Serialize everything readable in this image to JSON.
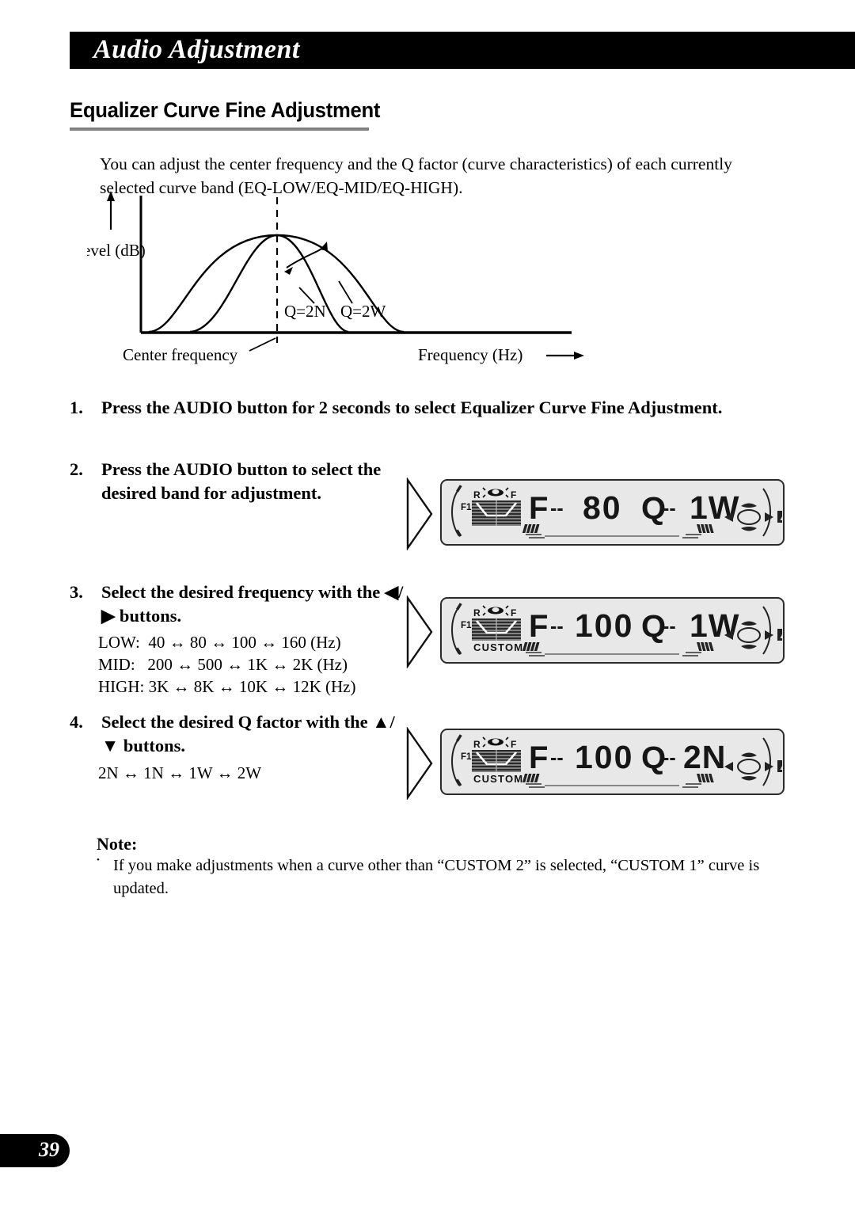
{
  "header": {
    "title": "Audio Adjustment"
  },
  "section": {
    "heading": "Equalizer Curve Fine Adjustment",
    "intro": "You can adjust the center frequency and the Q factor (curve characteristics) of each currently selected curve band (EQ-LOW/EQ-MID/EQ-HIGH)."
  },
  "diagram": {
    "y_axis_label": "Level (dB)",
    "x_axis_label": "Frequency (Hz)",
    "center_label": "Center frequency",
    "curve_narrow_label": "Q=2N",
    "curve_wide_label": "Q=2W"
  },
  "steps": [
    {
      "number": "1.",
      "text": "Press the AUDIO button for 2 seconds to select Equalizer Curve Fine Adjustment."
    },
    {
      "number": "2.",
      "text": "Press the AUDIO button to select the desired band for adjustment."
    },
    {
      "number": "3.",
      "text": "Select the desired frequency with the ◀/▶ buttons.",
      "list": "LOW:  40 ↔ 80 ↔ 100 ↔ 160 (Hz)\nMID:   200 ↔ 500 ↔ 1K ↔ 2K (Hz)\nHIGH: 3K ↔ 8K ↔ 10K ↔ 12K (Hz)"
    },
    {
      "number": "4.",
      "text": "Select the desired Q factor with the ▲/▼ buttons.",
      "list": "2N ↔ 1N ↔ 1W ↔ 2W"
    }
  ],
  "displays": [
    {
      "f_prefix": "F",
      "f_dashes": "--",
      "f_value": "80",
      "q_prefix": "Q",
      "q_dashes": "--",
      "q_value": "1W",
      "source_left": "F1",
      "fader_rear": "R",
      "fader_front": "F",
      "custom_label": ""
    },
    {
      "f_prefix": "F",
      "f_dashes": "--",
      "f_value": "100",
      "q_prefix": "Q",
      "q_dashes": "--",
      "q_value": "1W",
      "source_left": "F1",
      "fader_rear": "R",
      "fader_front": "F",
      "custom_label": "CUSTOM"
    },
    {
      "f_prefix": "F",
      "f_dashes": "--",
      "f_value": "100",
      "q_prefix": "Q",
      "q_dashes": "--",
      "q_value": "2N",
      "source_left": "F1",
      "fader_rear": "R",
      "fader_front": "F",
      "custom_label": "CUSTOM"
    }
  ],
  "note": {
    "title": "Note:",
    "bullet": "•",
    "text": "If you make adjustments when a curve other than “CUSTOM 2” is selected, “CUSTOM 1” curve is updated."
  },
  "footer": {
    "page_number": "39"
  }
}
